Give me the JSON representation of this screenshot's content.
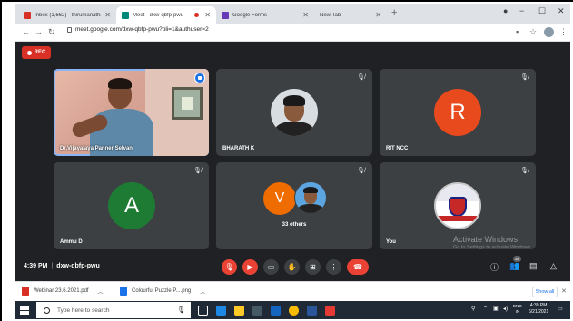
{
  "browser": {
    "tabs": [
      {
        "title": "Inbox (1,662) - thirumanathar",
        "favicon_color": "#d93025",
        "active": false
      },
      {
        "title": "Meet - dxw-qbfp-pwu",
        "favicon_color": "#00897b",
        "active": true
      },
      {
        "title": "Google Forms",
        "favicon_color": "#673ab7",
        "active": false
      },
      {
        "title": "New Tab",
        "favicon_color": "#dee1e6",
        "active": false
      }
    ],
    "url": "meet.google.com/dxw-qbfp-pwu?pli=1&authuser=2"
  },
  "meet": {
    "rec_label": "REC",
    "participants": [
      {
        "name": "Dr.Vijayalaya Panner Selvan",
        "type": "video",
        "speaking": true
      },
      {
        "name": "BHARATH K",
        "type": "photo",
        "muted": true
      },
      {
        "name": "RIT NCC",
        "type": "initial",
        "initial": "R",
        "color": "#e8491d",
        "muted": true
      },
      {
        "name": "Ammu D",
        "type": "initial",
        "initial": "A",
        "color": "#1e7b34",
        "muted": true
      },
      {
        "name": "33 others",
        "type": "group",
        "initial": "V",
        "color": "#ef6c00",
        "muted": true
      },
      {
        "name": "You",
        "type": "logo",
        "muted": true
      }
    ],
    "time": "4:39 PM",
    "meeting_code": "dxw-qbfp-pwu",
    "participant_count": "38",
    "activate_title": "Activate Windows",
    "activate_sub": "Go to Settings to activate Windows."
  },
  "downloads": {
    "items": [
      {
        "name": "Webinar 23.6.2021.pdf",
        "icon_color": "#d93025"
      },
      {
        "name": "Colourful Puzzle P....png",
        "icon_color": "#1a73e8"
      }
    ],
    "show_all": "Show all"
  },
  "taskbar": {
    "search_placeholder": "Type here to search",
    "lang_top": "ENG",
    "lang_bottom": "IN",
    "time": "4:39 PM",
    "date": "6/21/2021"
  }
}
